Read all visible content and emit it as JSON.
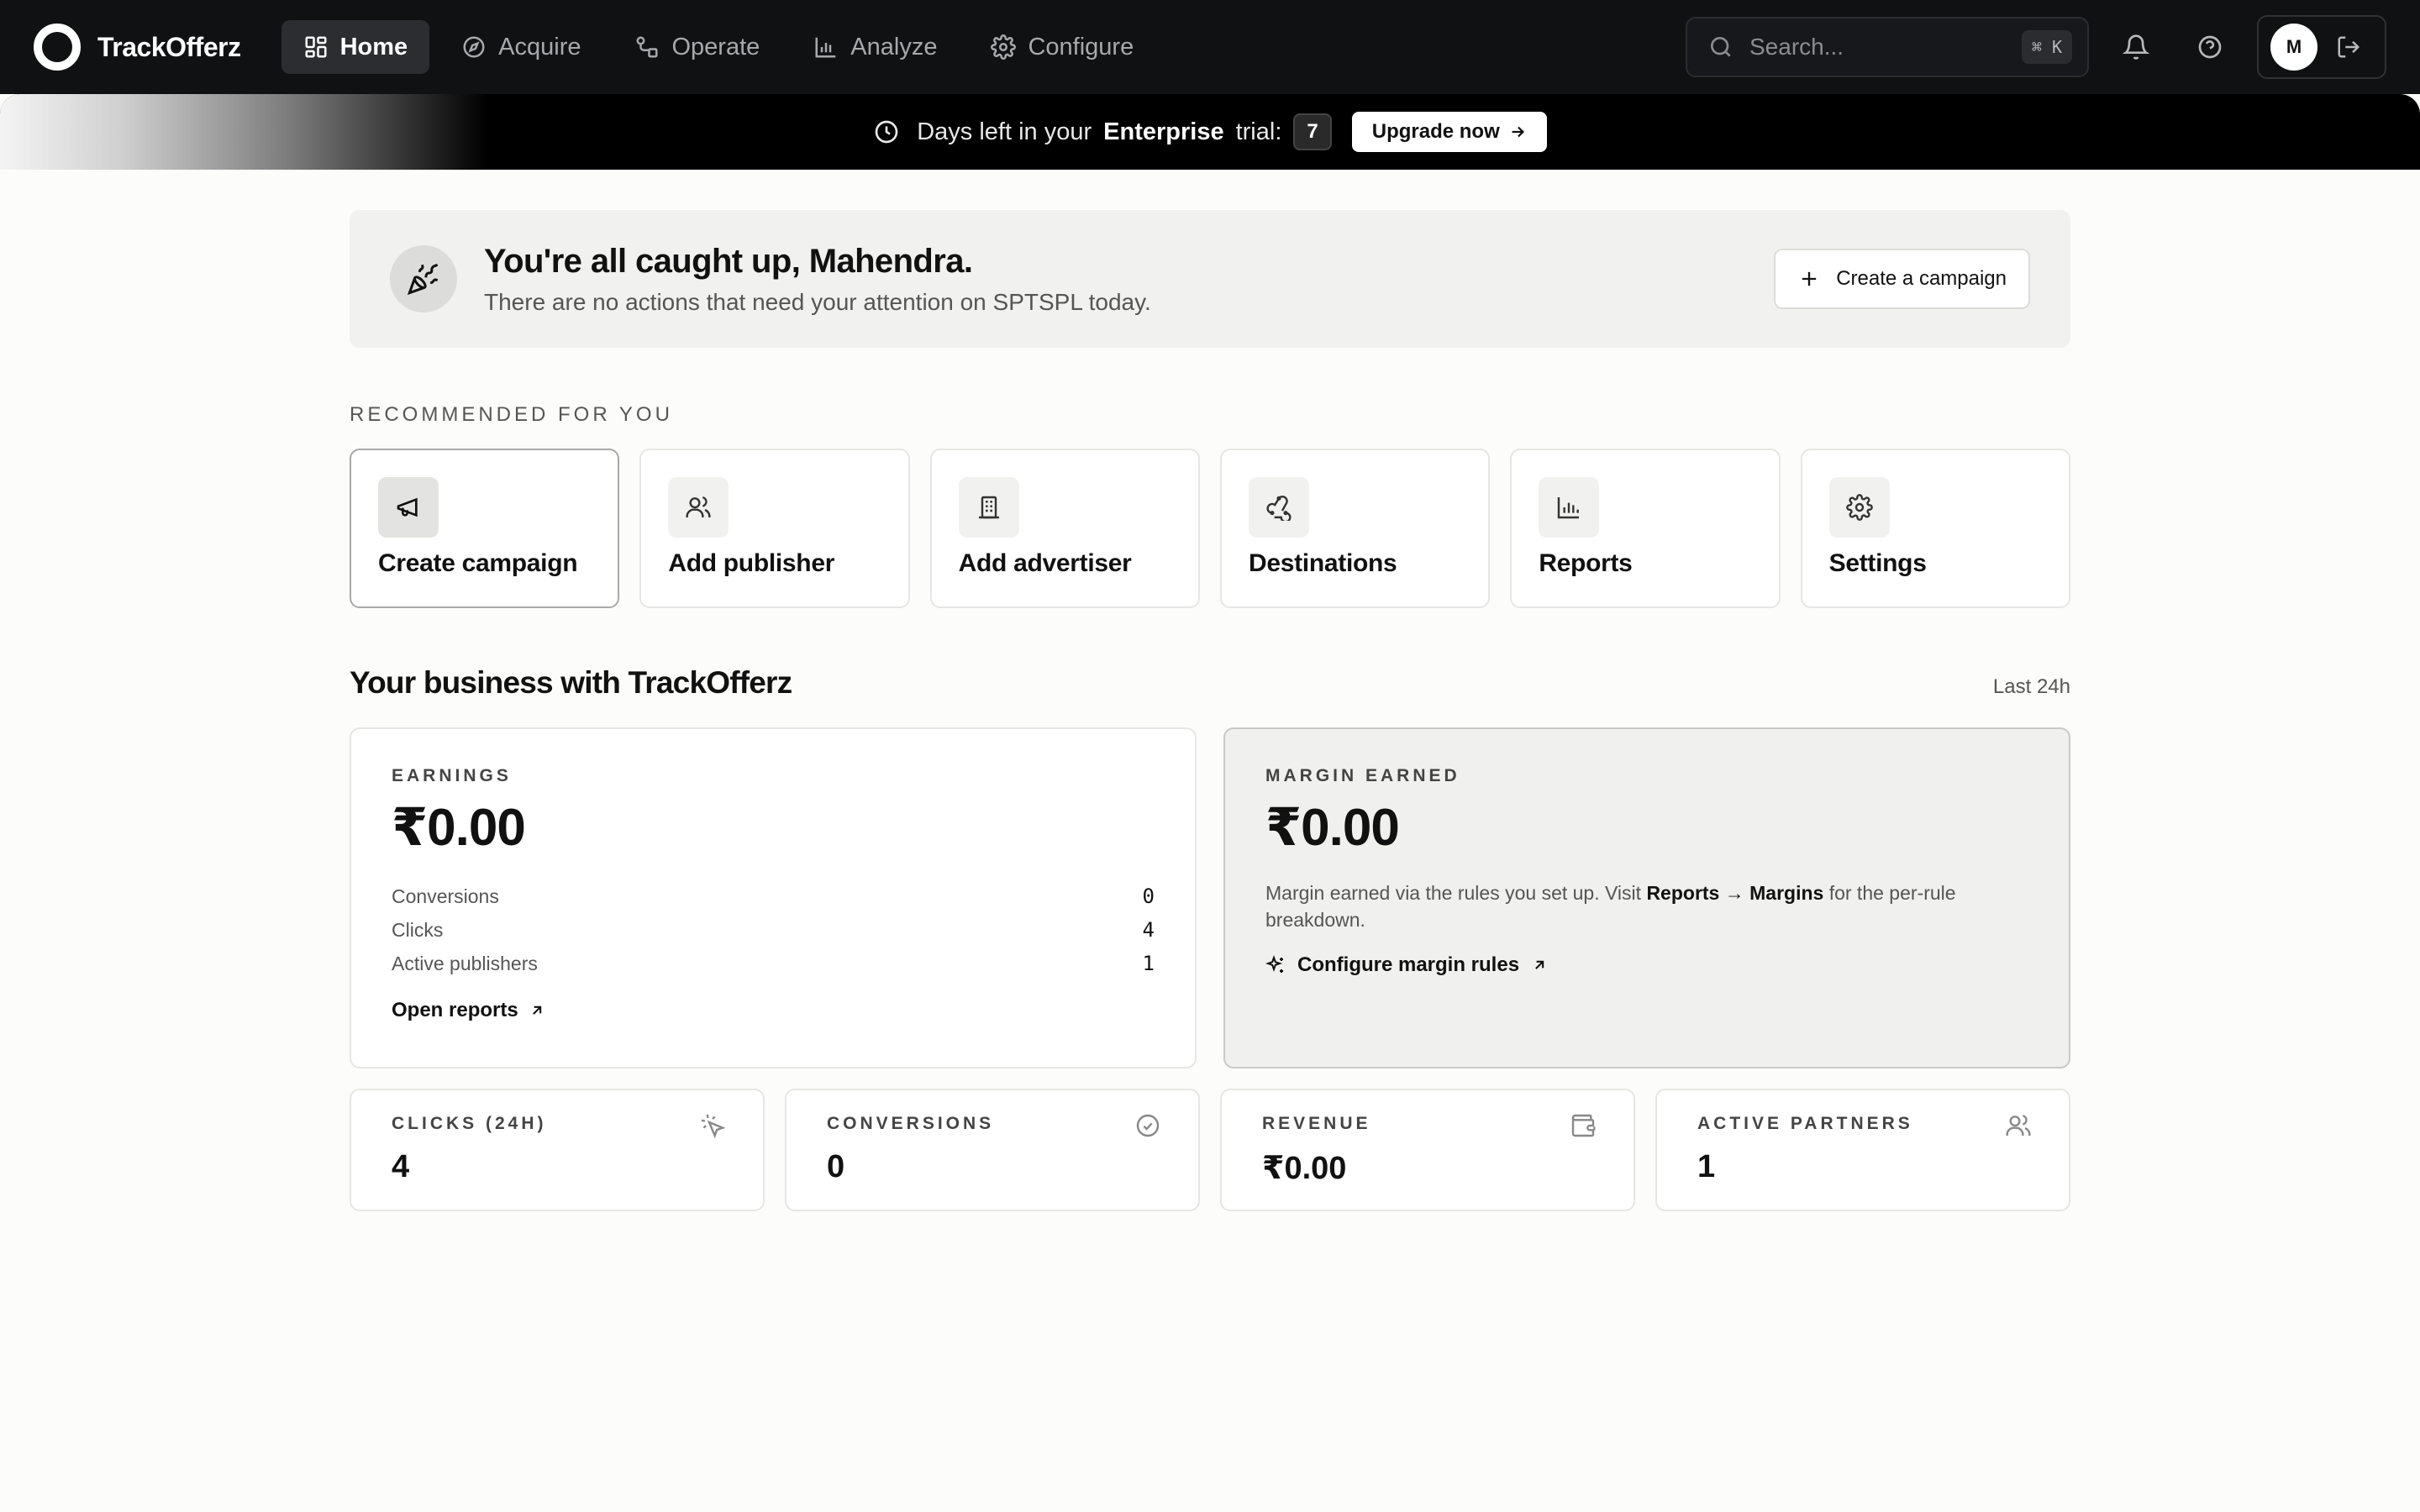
{
  "app": {
    "name": "TrackOfferz"
  },
  "nav": {
    "items": [
      {
        "label": "Home",
        "icon": "home-grid-icon",
        "active": true
      },
      {
        "label": "Acquire",
        "icon": "compass-icon"
      },
      {
        "label": "Operate",
        "icon": "operate-icon"
      },
      {
        "label": "Analyze",
        "icon": "bar-chart-icon"
      },
      {
        "label": "Configure",
        "icon": "gear-icon"
      }
    ]
  },
  "search": {
    "placeholder": "Search...",
    "shortcut": "⌘ K"
  },
  "user": {
    "initial": "M"
  },
  "trial": {
    "prefix": "Days left in your",
    "plan": "Enterprise",
    "suffix": "trial:",
    "days": "7",
    "upgrade_label": "Upgrade now"
  },
  "caught_up": {
    "title": "You're all caught up, Mahendra.",
    "subtitle": "There are no actions that need your attention on SPTSPL today.",
    "button_label": "Create a campaign"
  },
  "recommended": {
    "heading": "RECOMMENDED FOR YOU",
    "items": [
      {
        "label": "Create campaign",
        "icon": "megaphone-icon"
      },
      {
        "label": "Add publisher",
        "icon": "users-icon"
      },
      {
        "label": "Add advertiser",
        "icon": "building-icon"
      },
      {
        "label": "Destinations",
        "icon": "webhook-icon"
      },
      {
        "label": "Reports",
        "icon": "bar-chart-icon"
      },
      {
        "label": "Settings",
        "icon": "gear-icon"
      }
    ]
  },
  "business": {
    "title": "Your business with TrackOfferz",
    "range": "Last 24h",
    "earnings": {
      "label": "EARNINGS",
      "value": "₹0.00",
      "rows": [
        {
          "label": "Conversions",
          "value": "0"
        },
        {
          "label": "Clicks",
          "value": "4"
        },
        {
          "label": "Active publishers",
          "value": "1"
        }
      ],
      "link": "Open reports"
    },
    "margin": {
      "label": "MARGIN EARNED",
      "value": "₹0.00",
      "desc_prefix": "Margin earned via the rules you set up. Visit",
      "desc_bold": "Reports → Margins",
      "desc_suffix": "for the per-rule breakdown.",
      "link": "Configure margin rules"
    }
  },
  "kpis": [
    {
      "label": "CLICKS (24H)",
      "value": "4",
      "icon": "cursor-click-icon"
    },
    {
      "label": "CONVERSIONS",
      "value": "0",
      "icon": "check-circle-icon"
    },
    {
      "label": "REVENUE",
      "value": "₹0.00",
      "icon": "wallet-icon"
    },
    {
      "label": "ACTIVE PARTNERS",
      "value": "1",
      "icon": "users-icon"
    }
  ]
}
